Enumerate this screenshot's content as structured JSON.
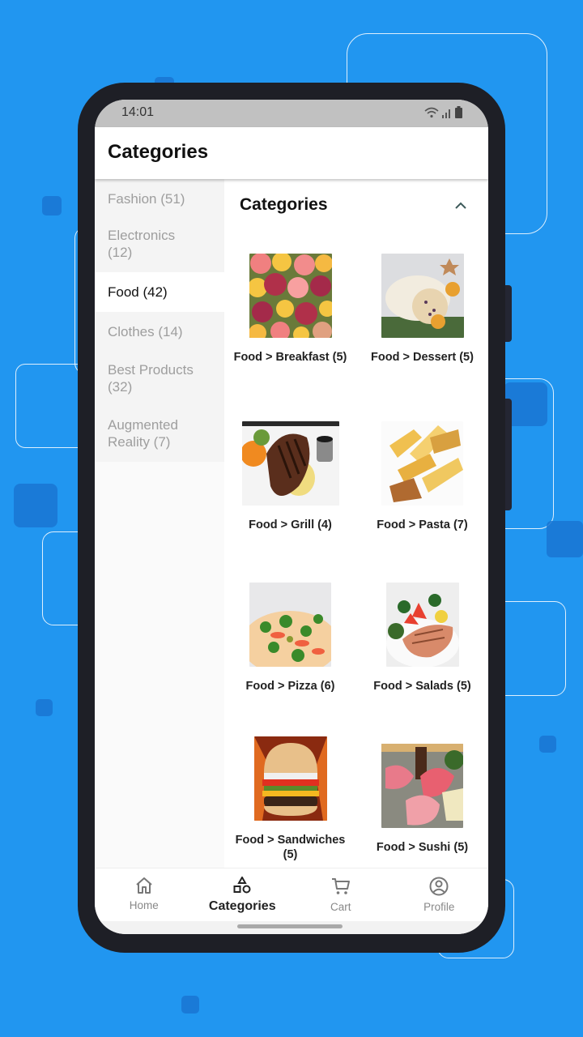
{
  "status_bar": {
    "time": "14:01",
    "icons": [
      "wifi-icon",
      "signal-icon",
      "battery-icon"
    ]
  },
  "app_bar": {
    "title": "Categories"
  },
  "sidebar": {
    "items": [
      {
        "label": "Fashion (51)",
        "active": false
      },
      {
        "label": "Electronics (12)",
        "active": false
      },
      {
        "label": "Food (42)",
        "active": true
      },
      {
        "label": "Clothes (14)",
        "active": false
      },
      {
        "label": "Best Products (32)",
        "active": false
      },
      {
        "label": "Augmented Reality (7)",
        "active": false
      }
    ]
  },
  "content": {
    "section_title": "Categories",
    "collapse_icon": "chevron-up-icon",
    "tiles": [
      {
        "label": "Food  >  Breakfast (5)",
        "image": "fruit-image"
      },
      {
        "label": "Food  >  Dessert (5)",
        "image": "stollen-cake-image"
      },
      {
        "label": "Food  >  Grill (4)",
        "image": "steak-image"
      },
      {
        "label": "Food  >  Pasta (7)",
        "image": "pasta-image"
      },
      {
        "label": "Food  >  Pizza (6)",
        "image": "pizza-image"
      },
      {
        "label": "Food  >  Salads (5)",
        "image": "salmon-salad-image"
      },
      {
        "label": "Food  >  Sandwiches (5)",
        "image": "burger-image"
      },
      {
        "label": "Food  >  Sushi (5)",
        "image": "sashimi-image"
      }
    ]
  },
  "bottom_nav": {
    "items": [
      {
        "label": "Home",
        "icon": "home-icon",
        "active": false
      },
      {
        "label": "Categories",
        "icon": "categories-shapes-icon",
        "active": true
      },
      {
        "label": "Cart",
        "icon": "cart-icon",
        "active": false
      },
      {
        "label": "Profile",
        "icon": "profile-icon",
        "active": false
      }
    ]
  },
  "colors": {
    "background": "#2196F0",
    "phone_frame": "#1e1f26",
    "active_text": "#111111",
    "inactive_text": "#9e9e9e"
  }
}
